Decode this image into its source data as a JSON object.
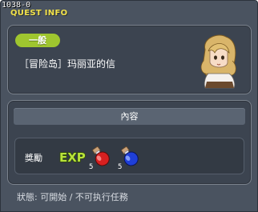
{
  "window": {
    "id": "1038-0",
    "title": "QUEST INFO"
  },
  "quest": {
    "category_badge": "一般",
    "name": "［冒险岛］玛丽亚的信",
    "npc_portrait": "npc-maria-portrait"
  },
  "content": {
    "tab_label": "內容",
    "reward_label": "獎勵",
    "rewards": [
      {
        "icon": "exp-icon",
        "text": "EXP"
      },
      {
        "icon": "red-potion-icon",
        "count": "5"
      },
      {
        "icon": "blue-potion-icon",
        "count": "5"
      }
    ]
  },
  "status": {
    "text": "狀態: 可開始 / 不可执行任務"
  },
  "colors": {
    "title": "#f2e24a",
    "badge": "#9fc62f",
    "panel": "#3c4450",
    "window": "#4a5360"
  }
}
